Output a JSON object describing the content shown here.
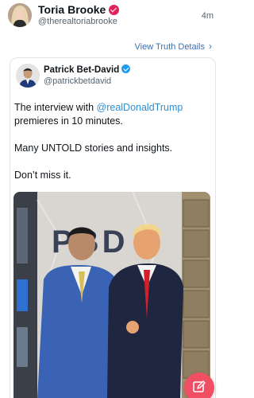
{
  "repost": {
    "author_name": "Toria Brooke",
    "author_handle": "@therealtoriabrooke",
    "timestamp": "4m",
    "badge_color": "#e0245e"
  },
  "view_details": {
    "label": "View Truth Details",
    "icon": "chevron-right-icon"
  },
  "quoted_post": {
    "author_name": "Patrick Bet-David",
    "author_handle": "@patrickbetdavid",
    "badge_color": "#1d9bf0",
    "text_line1_prefix": "The interview with ",
    "mention": "@realDonaldTrump",
    "text_line1_suffix": "premieres in 10 minutes.",
    "text_line2": "Many UNTOLD stories and insights.",
    "text_line3": "Don’t miss it.",
    "image_sign": "PBD"
  },
  "compose_button": {
    "icon": "pencil-square-icon",
    "color": "#ef4e63"
  }
}
